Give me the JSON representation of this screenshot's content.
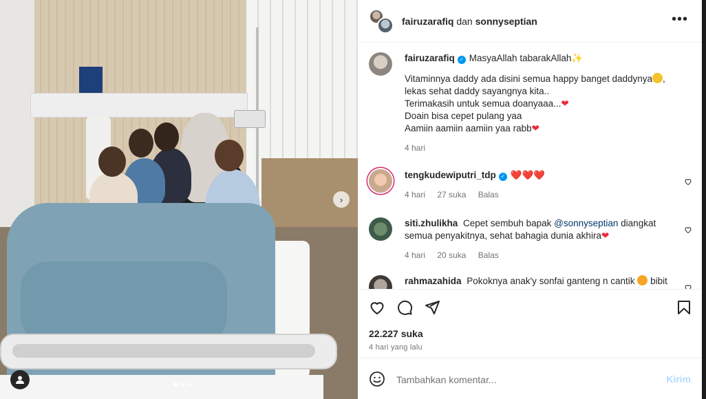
{
  "header": {
    "user1": "fairuzarafiq",
    "connector": "dan",
    "user2": "sonnyseptian"
  },
  "caption": {
    "username": "fairuzarafiq",
    "first_line": "MasyaAllah tabarakAllah",
    "line1": "Vitaminnya daddy ada disini semua happy banget daddynya",
    "line2": "lekas sehat daddy sayangnya kita..",
    "line3": "Terimakasih untuk semua doanyaaa...",
    "line4": "Doain bisa cepet pulang yaa",
    "line5": "Aamiin aamiin aamiin yaa rabb",
    "time": "4 hari"
  },
  "comments": [
    {
      "username": "tengkudewiputri_tdp",
      "hearts": "❤️❤️❤️",
      "time": "4 hari",
      "likes": "27 suka",
      "reply": "Balas"
    },
    {
      "username": "siti.zhulikha",
      "text_a": "Cepet sembuh bapak",
      "mention": "@sonnyseptian",
      "text_b": "diangkat semua penyakitnya, sehat bahagia dunia akhira",
      "time": "4 hari",
      "likes": "20 suka",
      "reply": "Balas"
    },
    {
      "username": "rahmazahida",
      "text": "Pokoknya anak'y sonfai ganteng n cantik",
      "text_end": "bibit"
    }
  ],
  "actions": {
    "likes": "22.227 suka",
    "posted": "4 hari yang lalu"
  },
  "comment_box": {
    "placeholder": "Tambahkan komentar...",
    "send": "Kirim"
  },
  "colors": {
    "verified": "#0095f6",
    "heart": "#ed2a3a",
    "send_disabled": "#b3dbff"
  }
}
